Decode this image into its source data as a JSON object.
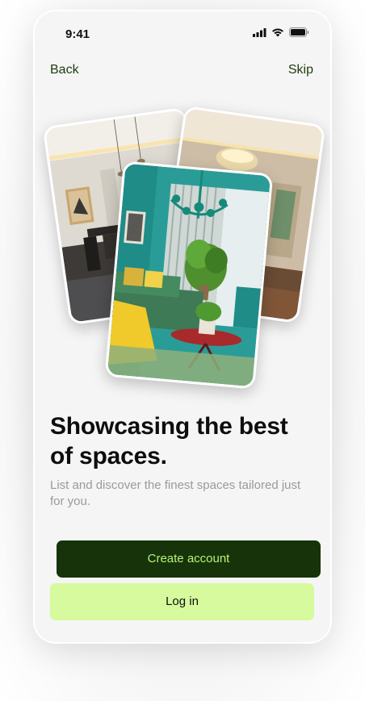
{
  "status_bar": {
    "time": "9:41",
    "icons": [
      "signal-icon",
      "wifi-icon",
      "battery-icon"
    ]
  },
  "nav": {
    "back_label": "Back",
    "skip_label": "Skip"
  },
  "gallery": {
    "images": [
      "modern-dining-room",
      "luxury-living-room",
      "teal-living-room"
    ]
  },
  "content": {
    "headline": "Showcasing the best of spaces.",
    "subtitle": "List and discover the finest spaces tailored just for you."
  },
  "actions": {
    "create_account_label": "Create account",
    "login_label": "Log in"
  },
  "colors": {
    "primary_dark_green": "#163309",
    "primary_text_lime": "#b8f27a",
    "secondary_lime": "#d6fa9d",
    "link_green": "#1e3a0f"
  }
}
